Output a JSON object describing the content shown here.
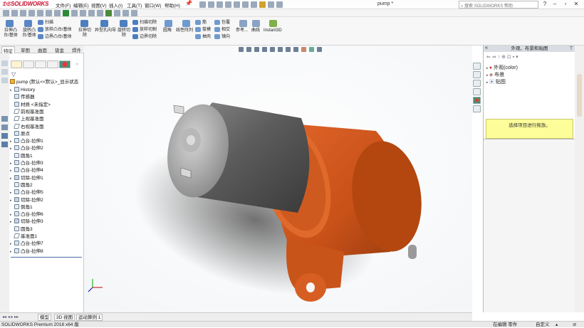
{
  "app": {
    "logo": "SOLIDWORKS",
    "doc_title": "pump *",
    "search_placeholder": "搜索 SOLIDWORKS 帮助",
    "pin": "📌"
  },
  "menu": [
    {
      "label": "文件(F)"
    },
    {
      "label": "编辑(E)"
    },
    {
      "label": "视图(V)"
    },
    {
      "label": "插入(I)"
    },
    {
      "label": "工具(T)"
    },
    {
      "label": "窗口(W)"
    },
    {
      "label": "帮助(H)"
    }
  ],
  "ribbon": {
    "boss_extrude": "拉伸凸\n台/基体",
    "boss_revolve": "旋转凸\n台/基体",
    "sweep": "扫描",
    "loft": "放样凸台/基体",
    "boundary_boss": "边界凸台/基体",
    "cut_extrude": "拉伸切\n除",
    "hole_wizard": "异型孔向导",
    "cut_revolve": "旋转切\n除",
    "swept_cut": "扫描切除",
    "lofted_cut": "放样切割",
    "boundary_cut": "边界切除",
    "fillet": "圆角",
    "linear_pattern": "线性阵列",
    "rib": "筋",
    "draft": "拔模",
    "shell": "抽壳",
    "wrap": "包覆",
    "intersect": "相交",
    "mirror": "镜向",
    "reference": "参考...",
    "curves": "曲线",
    "instant3d": "Instant3D"
  },
  "tabs": [
    {
      "label": "特征",
      "active": true
    },
    {
      "label": "草图",
      "active": false
    },
    {
      "label": "曲面",
      "active": false
    },
    {
      "label": "钣金",
      "active": false
    },
    {
      "label": "焊件",
      "active": false
    },
    {
      "label": "评估",
      "active": false
    }
  ],
  "tree": {
    "root": "pump  (默认<<默认>_显示状态",
    "items": [
      {
        "label": "History",
        "icon": "history-icon",
        "expand": true
      },
      {
        "label": "传感器",
        "icon": "sensor-icon",
        "expand": false
      },
      {
        "label": "材质 <未指定>",
        "icon": "material-icon",
        "expand": false
      },
      {
        "label": "前视基准面",
        "icon": "plane-icon",
        "expand": false
      },
      {
        "label": "上视基准面",
        "icon": "plane-icon",
        "expand": false
      },
      {
        "label": "右视基准面",
        "icon": "plane-icon",
        "expand": false
      },
      {
        "label": "原点",
        "icon": "origin-icon",
        "expand": false
      },
      {
        "label": "凸台-拉伸1",
        "icon": "extrude-icon",
        "expand": true
      },
      {
        "label": "凸台-拉伸2",
        "icon": "extrude-icon",
        "expand": true
      },
      {
        "label": "圆角1",
        "icon": "fillet-icon",
        "expand": false
      },
      {
        "label": "凸台-拉伸3",
        "icon": "extrude-icon",
        "expand": true
      },
      {
        "label": "凸台-拉伸4",
        "icon": "extrude-icon",
        "expand": true
      },
      {
        "label": "切除-拉伸1",
        "icon": "cut-icon",
        "expand": true
      },
      {
        "label": "圆角2",
        "icon": "fillet-icon",
        "expand": false
      },
      {
        "label": "凸台-拉伸5",
        "icon": "extrude-icon",
        "expand": true
      },
      {
        "label": "切除-拉伸2",
        "icon": "cut-icon",
        "expand": true
      },
      {
        "label": "倒角1",
        "icon": "chamfer-icon",
        "expand": false
      },
      {
        "label": "凸台-拉伸6",
        "icon": "extrude-icon",
        "expand": true
      },
      {
        "label": "切除-拉伸3",
        "icon": "cut-icon",
        "expand": true
      },
      {
        "label": "圆角3",
        "icon": "fillet-icon",
        "expand": false
      },
      {
        "label": "基准面1",
        "icon": "plane-icon",
        "expand": false
      },
      {
        "label": "凸台-拉伸7",
        "icon": "extrude-icon",
        "expand": true
      },
      {
        "label": "凸台-拉伸8",
        "icon": "extrude-icon",
        "expand": true
      }
    ]
  },
  "appearance_panel": {
    "title": "外观、布景和贴图",
    "items": [
      {
        "label": "外观(color)"
      },
      {
        "label": "布景"
      },
      {
        "label": "贴图"
      }
    ],
    "hint": "选择项目进行拖放。"
  },
  "bottom_tabs": [
    {
      "label": "模型"
    },
    {
      "label": "3D 视图"
    },
    {
      "label": "运动算例 1"
    }
  ],
  "status": {
    "left": "SOLIDWORKS Premium 2018 x64 版",
    "edit": "在编辑 零件",
    "custom": "自定义"
  },
  "colors": {
    "accent": "#c8102e",
    "body_orange": "#d35a20",
    "motor_gray": "#6a6a6a"
  }
}
